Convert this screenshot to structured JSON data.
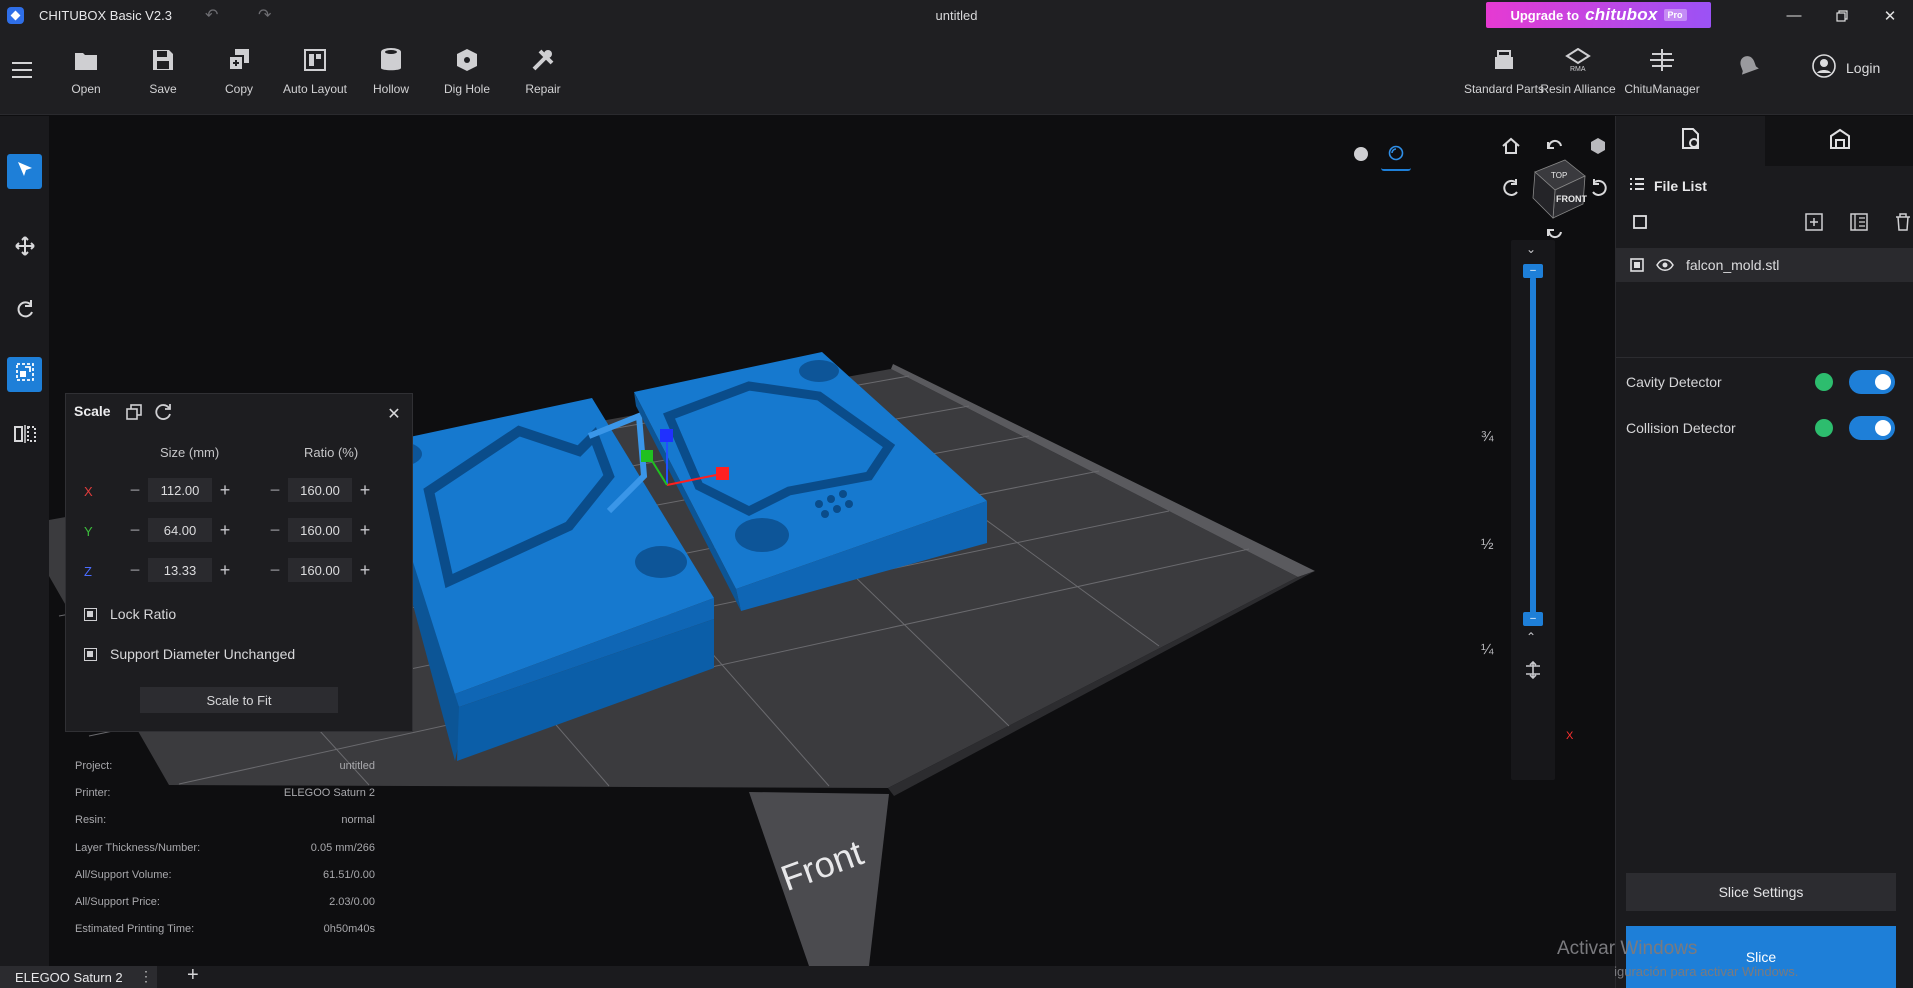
{
  "titlebar": {
    "app_title": "CHITUBOX Basic V2.3",
    "document_title": "untitled",
    "upgrade": {
      "prefix": "Upgrade to",
      "brand": "chitubox",
      "badge": "Pro"
    }
  },
  "toolbar": {
    "tools": [
      {
        "label": "Open",
        "icon": "folder-icon"
      },
      {
        "label": "Save",
        "icon": "save-icon"
      },
      {
        "label": "Copy",
        "icon": "copy-icon"
      },
      {
        "label": "Auto Layout",
        "icon": "auto-layout-icon"
      },
      {
        "label": "Hollow",
        "icon": "hollow-icon"
      },
      {
        "label": "Dig Hole",
        "icon": "dig-hole-icon"
      },
      {
        "label": "Repair",
        "icon": "repair-icon"
      }
    ],
    "right_tools": [
      {
        "label": "Standard Parts",
        "icon": "standard-parts-icon"
      },
      {
        "label": "Resin Alliance",
        "icon": "resin-alliance-icon"
      },
      {
        "label": "ChituManager",
        "icon": "chitumanager-icon"
      }
    ],
    "login_label": "Login"
  },
  "viewport": {
    "view_cube": {
      "top": "TOP",
      "front": "FRONT"
    },
    "layer_fractions": [
      "¾",
      "½",
      "¼"
    ],
    "plate_label": "Front",
    "scale_panel": {
      "title": "Scale",
      "size_header": "Size (mm)",
      "ratio_header": "Ratio (%)",
      "rows": [
        {
          "axis": "X",
          "size": "112.00",
          "ratio": "160.00"
        },
        {
          "axis": "Y",
          "size": "64.00",
          "ratio": "160.00"
        },
        {
          "axis": "Z",
          "size": "13.33",
          "ratio": "160.00"
        }
      ],
      "lock_ratio": "Lock Ratio",
      "support_unchanged": "Support Diameter Unchanged",
      "scale_to_fit": "Scale to Fit"
    },
    "info": [
      {
        "label": "Project:",
        "value": "untitled"
      },
      {
        "label": "Printer:",
        "value": "ELEGOO Saturn 2"
      },
      {
        "label": "Resin:",
        "value": "normal"
      },
      {
        "label": "Layer Thickness/Number:",
        "value": "0.05 mm/266"
      },
      {
        "label": "All/Support Volume:",
        "value": "61.51/0.00"
      },
      {
        "label": "All/Support Price:",
        "value": "2.03/0.00"
      },
      {
        "label": "Estimated Printing Time:",
        "value": "0h50m40s"
      }
    ],
    "watermark": {
      "line1": "Activar Windows",
      "line2": "Ve a Configuración para activar Windows."
    },
    "axes": {
      "x": "X",
      "y": "Y",
      "z": "Z"
    }
  },
  "right_panel": {
    "file_list_title": "File List",
    "files": [
      {
        "name": "falcon_mold.stl"
      }
    ],
    "detectors": [
      {
        "label": "Cavity Detector",
        "enabled": true
      },
      {
        "label": "Collision Detector",
        "enabled": true
      }
    ],
    "slice_settings": "Slice Settings",
    "slice": "Slice"
  },
  "bottom_bar": {
    "printer": "ELEGOO Saturn 2",
    "more": "⋮",
    "add": "+"
  },
  "colors": {
    "accent": "#1e7fd8",
    "model": "#1673c8",
    "upgrade_start": "#e63ad2",
    "upgrade_end": "#9b52f5",
    "ok": "#2dbd6e"
  }
}
